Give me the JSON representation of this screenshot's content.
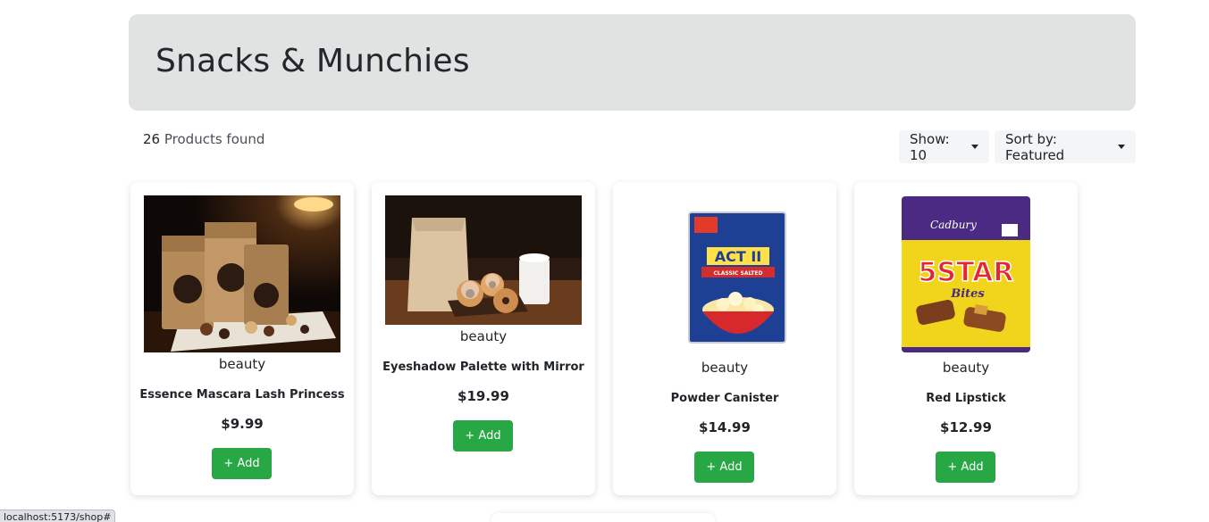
{
  "header": {
    "title": "Snacks & Munchies"
  },
  "results": {
    "count": "26",
    "label": "Products found"
  },
  "controls": {
    "show_label": "Show: 10",
    "sort_label": "Sort by: Featured"
  },
  "products": [
    {
      "category": "beauty",
      "name": "Essence Mascara Lash Princess",
      "price": "$9.99",
      "add_label": "+ Add",
      "image": "snack-bags-photo"
    },
    {
      "category": "beauty",
      "name": "Eyeshadow Palette with Mirror",
      "price": "$19.99",
      "add_label": "+ Add",
      "image": "donuts-paper-bag-photo"
    },
    {
      "category": "beauty",
      "name": "Powder Canister",
      "price": "$14.99",
      "add_label": "+ Add",
      "image": "act-ii-popcorn-pack"
    },
    {
      "category": "beauty",
      "name": "Red Lipstick",
      "price": "$12.99",
      "add_label": "+ Add",
      "image": "5star-bites-pack"
    }
  ],
  "product_images": {
    "act_ii_brand": "ACT II",
    "act_ii_flavor": "CLASSIC SALTED",
    "cadbury_brand": "Cadbury",
    "fivestar_brand": "5STAR",
    "fivestar_sub": "Bites"
  },
  "status_bar": {
    "url": "localhost:5173/shop#"
  },
  "colors": {
    "header_bg": "#e1e3e3",
    "add_button": "#28a745",
    "dropdown_bg": "#f4f5f6"
  }
}
